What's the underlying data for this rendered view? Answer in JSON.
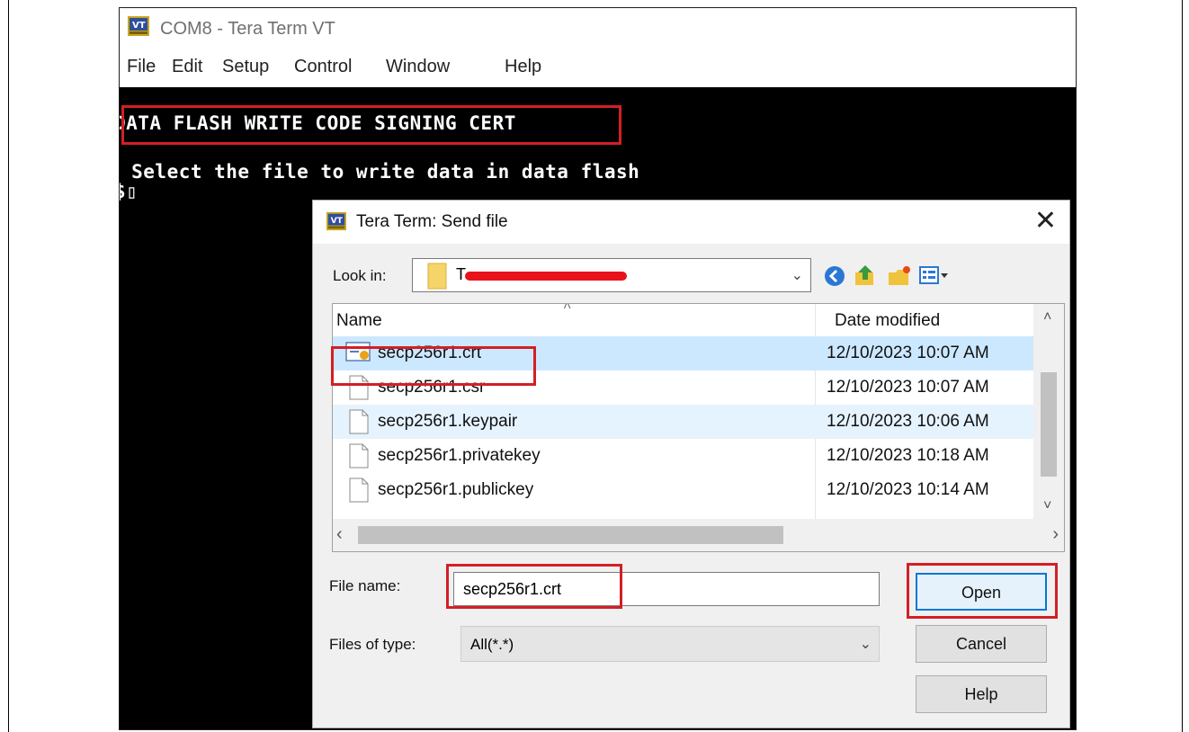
{
  "window": {
    "title": "COM8 - Tera Term VT",
    "icon": "vt-app-icon",
    "menu": [
      "File",
      "Edit",
      "Setup",
      "Control",
      "Window",
      "Help"
    ]
  },
  "terminal": {
    "line1": "DATA FLASH WRITE CODE SIGNING CERT",
    "line2": " Select the file to write data in data flash",
    "prompt": "$",
    "cursor": "▯"
  },
  "dialog": {
    "title": "Tera Term: Send file",
    "close": "✕",
    "look_in_label": "Look in:",
    "look_in_value": "T",
    "toolbar_icons": [
      "back-icon",
      "up-folder-icon",
      "new-folder-icon",
      "view-menu-icon"
    ],
    "columns": {
      "name": "Name",
      "date": "Date modified"
    },
    "files": [
      {
        "name": "secp256r1.crt",
        "date": "12/10/2023 10:07 AM",
        "icon": "certificate-icon",
        "selected": true
      },
      {
        "name": "secp256r1.csr",
        "date": "12/10/2023 10:07 AM",
        "icon": "file-icon",
        "selected": false
      },
      {
        "name": "secp256r1.keypair",
        "date": "12/10/2023 10:06 AM",
        "icon": "file-icon",
        "selected": false
      },
      {
        "name": "secp256r1.privatekey",
        "date": "12/10/2023 10:18 AM",
        "icon": "file-icon",
        "selected": false
      },
      {
        "name": "secp256r1.publickey",
        "date": "12/10/2023 10:14 AM",
        "icon": "file-icon",
        "selected": false
      }
    ],
    "file_name_label": "File name:",
    "file_name_value": "secp256r1.crt",
    "file_type_label": "Files of type:",
    "file_type_value": "All(*.*)",
    "buttons": {
      "open": "Open",
      "cancel": "Cancel",
      "help": "Help"
    }
  },
  "colors": {
    "highlight_box": "#d31f26",
    "selection": "#cce8ff",
    "terminal_bg": "#000000"
  }
}
